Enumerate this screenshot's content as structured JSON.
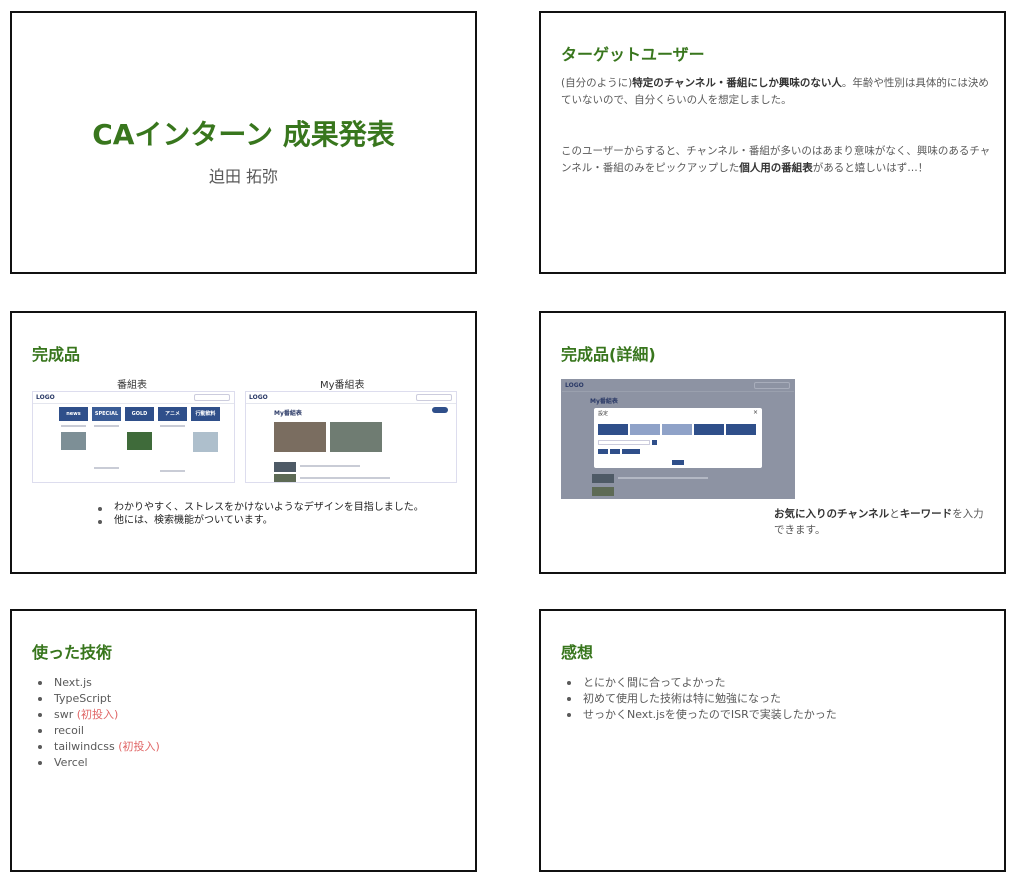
{
  "slide1": {
    "title": "CAインターン 成果発表",
    "author": "迫田 拓弥"
  },
  "slide2": {
    "heading": "ターゲットユーザー",
    "p1_a": "(自分のように)",
    "p1_b": "特定のチャンネル・番組にしか興味のない人",
    "p1_c": "。年齢や性別は具体的には決めていないので、自分くらいの人を想定しました。",
    "p2_a": "このユーザーからすると、チャンネル・番組が多いのはあまり意味がなく、興味のあるチャンネル・番組のみをピックアップした",
    "p2_b": "個人用の番組表",
    "p2_c": "があると嬉しいはず…！"
  },
  "slide3": {
    "heading": "完成品",
    "caption_left": "番組表",
    "caption_right": "My番組表",
    "mock_logo": "LOGO",
    "mock_mytitle": "My番組表",
    "mock_channels": [
      "news",
      "SPECIAL",
      "GOLD",
      "アニメ",
      "行動飲料"
    ],
    "bullets": [
      "わかりやすく、ストレスをかけないようなデザインを目指しました。",
      "他には、検索機能がついています。"
    ]
  },
  "slide4": {
    "heading": "完成品(詳細)",
    "mock_logo": "LOGO",
    "mock_mytitle": "My番組表",
    "modal_title": "設定",
    "text_a": "お気に入りのチャンネル",
    "text_b": "と",
    "text_c": "キーワード",
    "text_d": "を入力できます。"
  },
  "slide5": {
    "heading": "使った技術",
    "items": [
      {
        "name": "Next.js",
        "note": ""
      },
      {
        "name": "TypeScript",
        "note": ""
      },
      {
        "name": "swr ",
        "note": "(初投入)"
      },
      {
        "name": "recoil",
        "note": ""
      },
      {
        "name": "tailwindcss ",
        "note": "(初投入)"
      },
      {
        "name": "Vercel",
        "note": ""
      }
    ]
  },
  "slide6": {
    "heading": "感想",
    "items": [
      "とにかく間に合ってよかった",
      "初めて使用した技術は特に勉強になった",
      "せっかくNext.jsを使ったのでISRで実装したかった"
    ]
  },
  "colors": {
    "heading_green": "#38761d",
    "accent_red": "#e06666",
    "body_gray": "#595959"
  }
}
